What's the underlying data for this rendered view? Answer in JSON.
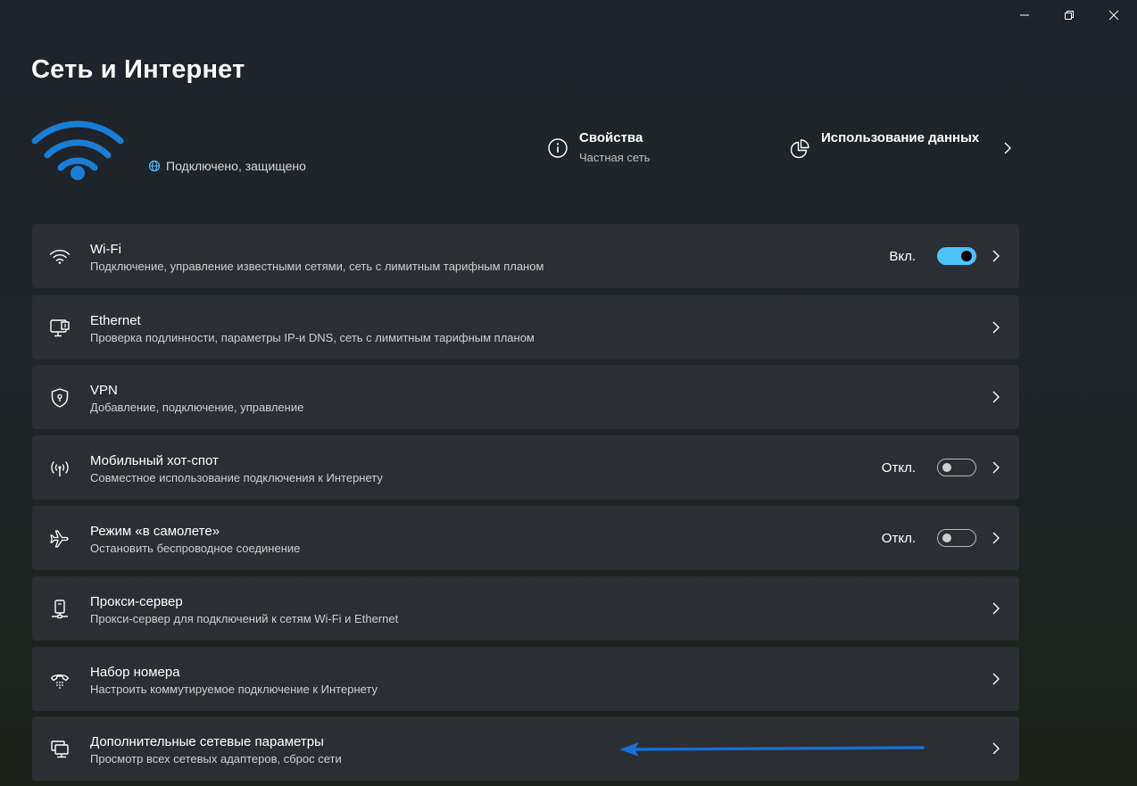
{
  "window": {
    "minimize_icon": "minimize-icon",
    "maximize_icon": "restore-icon",
    "close_icon": "close-icon"
  },
  "page": {
    "title": "Сеть и Интернет",
    "status": "Подключено, защищено",
    "accent": "#1a7fd4"
  },
  "header_links": {
    "properties": {
      "title": "Свойства",
      "subtitle": "Частная сеть",
      "icon": "info-icon"
    },
    "data_usage": {
      "title": "Использование данных",
      "icon": "pie-chart-icon"
    }
  },
  "items": [
    {
      "title": "Wi-Fi",
      "subtitle": "Подключение, управление известными сетями, сеть с лимитным тарифным планом",
      "state": "Вкл.",
      "toggle": true,
      "icon": "wifi-icon"
    },
    {
      "title": "Ethernet",
      "subtitle": "Проверка подлинности, параметры IP-и DNS, сеть с лимитным тарифным планом",
      "icon": "ethernet-icon"
    },
    {
      "title": "VPN",
      "subtitle": "Добавление, подключение, управление",
      "icon": "vpn-shield-icon"
    },
    {
      "title": "Мобильный хот-спот",
      "subtitle": "Совместное использование подключения к Интернету",
      "state": "Откл.",
      "toggle": false,
      "icon": "hotspot-icon"
    },
    {
      "title": "Режим «в самолете»",
      "subtitle": "Остановить беспроводное соединение",
      "state": "Откл.",
      "toggle": false,
      "icon": "airplane-icon"
    },
    {
      "title": "Прокси-сервер",
      "subtitle": "Прокси-сервер для подключений к сетям Wi-Fi и Ethernet",
      "icon": "proxy-icon"
    },
    {
      "title": "Набор номера",
      "subtitle": "Настроить коммутируемое подключение к Интернету",
      "icon": "dialup-icon"
    },
    {
      "title": "Дополнительные сетевые параметры",
      "subtitle": "Просмотр всех сетевых адаптеров, сброс сети",
      "icon": "network-adapters-icon"
    }
  ],
  "colors": {
    "toggle_on": "#4cc2ff",
    "annotation_arrow": "#1a6fd1"
  }
}
